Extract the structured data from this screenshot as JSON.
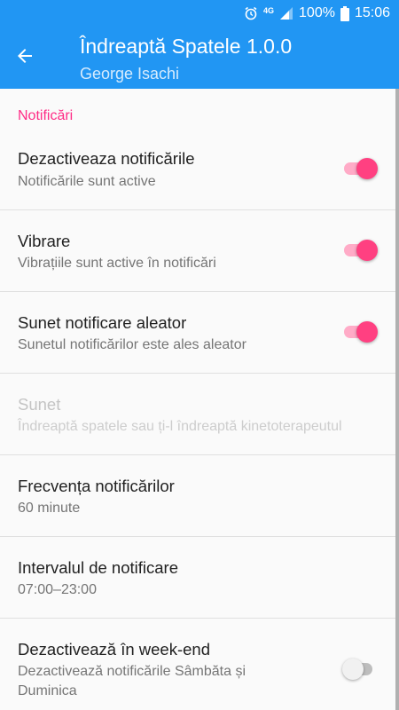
{
  "status_bar": {
    "network": "4G",
    "battery": "100%",
    "time": "15:06"
  },
  "app_bar": {
    "title": "Îndreaptă Spatele 1.0.0",
    "subtitle": "George Isachi"
  },
  "section": {
    "header": "Notificări"
  },
  "preferences": [
    {
      "title": "Dezactiveaza notificările",
      "summary": "Notificările sunt active",
      "switch": "on"
    },
    {
      "title": "Vibrare",
      "summary": "Vibrațiile sunt active în notificări",
      "switch": "on"
    },
    {
      "title": "Sunet notificare aleator",
      "summary": "Sunetul notificărilor este ales aleator",
      "switch": "on"
    },
    {
      "title": "Sunet",
      "summary": "Îndreaptă spatele sau ți-l îndreaptă kinetoterapeutul",
      "enabled": false
    },
    {
      "title": "Frecvența notificărilor",
      "summary": "60 minute"
    },
    {
      "title": "Intervalul de notificare",
      "summary": "07:00–23:00"
    },
    {
      "title": "Dezactivează în week-end",
      "summary": "Dezactivează notificările Sâmbăta și Duminica",
      "switch": "off"
    }
  ],
  "colors": {
    "primary": "#2196f3",
    "accent": "#ff4081",
    "section_header": "#ff2d87"
  }
}
